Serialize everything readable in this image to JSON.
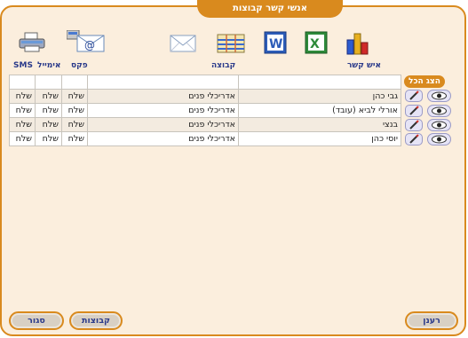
{
  "title": "אנשי קשר קבוצות",
  "columns": {
    "contact": "איש קשר",
    "group": "קבוצה",
    "fax": "פקס",
    "email": "אימייל",
    "sms": "SMS"
  },
  "show_all": "הצג הכל",
  "rows": [
    {
      "contact": "גבי כהן",
      "group": "אדריכלי פנים",
      "fax": "שלח",
      "email": "שלח",
      "sms": "שלח"
    },
    {
      "contact": "אורלי לביא (עובד)",
      "group": "אדריכלי פנים",
      "fax": "שלח",
      "email": "שלח",
      "sms": "שלח"
    },
    {
      "contact": "בנצי",
      "group": "אדריכלי פנים",
      "fax": "שלח",
      "email": "שלח",
      "sms": "שלח"
    },
    {
      "contact": "יוסי כהן",
      "group": "אדריכלי פנים",
      "fax": "שלח",
      "email": "שלח",
      "sms": "שלח"
    }
  ],
  "buttons": {
    "refresh": "רענן",
    "groups": "קבוצות",
    "close": "סגור"
  },
  "toolbar_icons": [
    "chart-icon",
    "excel-icon",
    "word-icon",
    "table-icon",
    "envelope-icon",
    "email-fax-icon",
    "printer-icon"
  ],
  "colors": {
    "accent": "#d98a1e",
    "panel": "#fbeedd",
    "header_text": "#2a3a8a"
  }
}
